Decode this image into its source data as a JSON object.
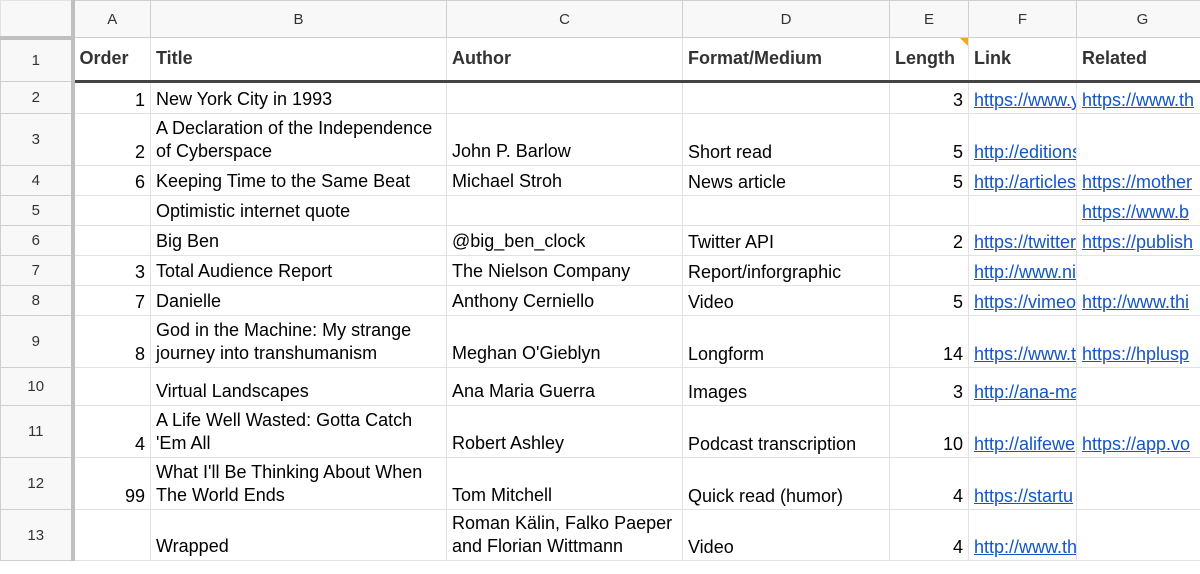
{
  "columns": [
    "A",
    "B",
    "C",
    "D",
    "E",
    "F",
    "G"
  ],
  "header": {
    "row_number": "1",
    "order": "Order",
    "title": "Title",
    "author": "Author",
    "format": "Format/Medium",
    "length": "Length",
    "link": "Link",
    "related": "Related"
  },
  "rows": [
    {
      "n": "2",
      "order": "1",
      "title": "New York City in 1993",
      "author": "",
      "format": "",
      "length": "3",
      "link": "https://www.y",
      "related": "https://www.th"
    },
    {
      "n": "3",
      "order": "2",
      "title": "A Declaration of the Independence of Cyberspace",
      "author": "John P. Barlow",
      "format": "Short read",
      "length": "5",
      "link": "http://editions",
      "related": ""
    },
    {
      "n": "4",
      "order": "6",
      "title": "Keeping Time to the Same Beat",
      "author": "Michael Stroh",
      "format": "News article",
      "length": "5",
      "link": "http://articles",
      "related": "https://mother"
    },
    {
      "n": "5",
      "order": "",
      "title": "Optimistic internet quote",
      "author": "",
      "format": "",
      "length": "",
      "link": "",
      "related": "https://www.b"
    },
    {
      "n": "6",
      "order": "",
      "title": "Big Ben",
      "author": "@big_ben_clock",
      "format": "Twitter API",
      "length": "2",
      "link": "https://twitter",
      "related": "https://publish"
    },
    {
      "n": "7",
      "order": "3",
      "title": "Total Audience Report",
      "author": "The Nielson Company",
      "format": "Report/inforgraphic",
      "length": "",
      "link": "http://www.ni",
      "related": ""
    },
    {
      "n": "8",
      "order": "7",
      "title": "Danielle",
      "author": "Anthony Cerniello",
      "format": "Video",
      "length": "5",
      "link": "https://vimeo",
      "related": "http://www.thi"
    },
    {
      "n": "9",
      "order": "8",
      "title": "God in the Machine: My strange journey into transhumanism",
      "author": "Meghan O'Gieblyn",
      "format": "Longform",
      "length": "14",
      "link": "https://www.t",
      "related": "https://hplusp"
    },
    {
      "n": "10",
      "order": "",
      "title": "Virtual Landscapes",
      "author": "Ana Maria Guerra",
      "format": "Images",
      "length": "3",
      "link": "http://ana-ma",
      "related": ""
    },
    {
      "n": "11",
      "order": "4",
      "title": "A Life Well Wasted: Gotta Catch 'Em All",
      "author": "Robert Ashley",
      "format": "Podcast transcription",
      "length": "10",
      "link": "http://alifewe",
      "related": "https://app.vo"
    },
    {
      "n": "12",
      "order": "99",
      "title": "What I'll Be Thinking About When The World Ends",
      "author": "Tom Mitchell",
      "format": "Quick read (humor)",
      "length": "4",
      "link": "https://startu",
      "related": ""
    },
    {
      "n": "13",
      "order": "",
      "title": "Wrapped",
      "author": "Roman Kälin, Falko Paeper and Florian Wittmann",
      "format": "Video",
      "length": "4",
      "link": "http://www.th",
      "related": ""
    }
  ],
  "colors": {
    "link": "#1155cc",
    "header_bg": "#f8f8f8",
    "gridline": "#e2e2e2",
    "note_marker": "#f5a623"
  }
}
